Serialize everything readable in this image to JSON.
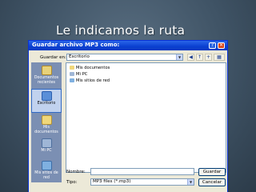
{
  "slide": {
    "title": "Le indicamos la ruta"
  },
  "dialog": {
    "title": "Guardar archivo MP3 como:",
    "help_glyph": "?",
    "close_glyph": "✕",
    "save_in_label": "Guardar en:",
    "save_in_value": "Escritorio",
    "places": [
      {
        "label": "Documentos recientes"
      },
      {
        "label": "Escritorio"
      },
      {
        "label": "Mis documentos"
      },
      {
        "label": "Mi PC"
      },
      {
        "label": "Mis sitios de red"
      }
    ],
    "files": [
      {
        "name": "Mis documentos"
      },
      {
        "name": "Mi PC"
      },
      {
        "name": "Mis sitios de red"
      }
    ],
    "filename_label": "Nombre:",
    "filename_value": "",
    "filetype_label": "Tipo:",
    "filetype_value": "MP3 files (*.mp3)",
    "save_button": "Guardar",
    "cancel_button": "Cancelar"
  },
  "colors": {
    "titlebar": "#0a3fd0",
    "dialog_bg": "#ece9d8",
    "places_bar": "#7b8fb3",
    "slide_bg": "#3f5365"
  },
  "icons": {
    "up_folder": "up-folder-icon",
    "new_folder": "new-folder-icon",
    "views": "views-menu-icon",
    "back": "back-icon"
  }
}
